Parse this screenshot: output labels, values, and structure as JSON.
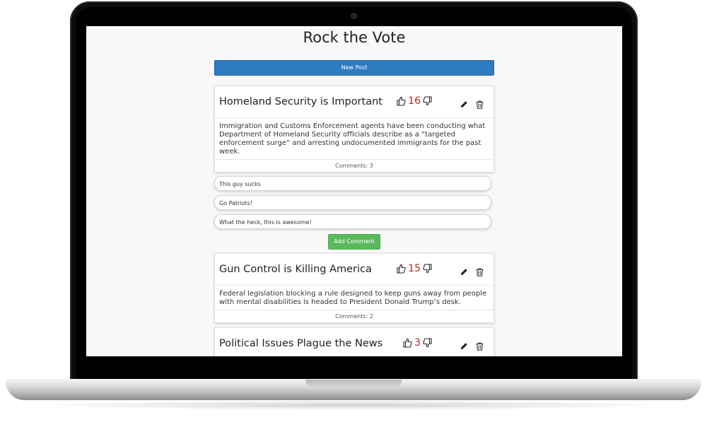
{
  "app": {
    "title": "Rock the Vote",
    "new_post_label": "New Post",
    "add_comment_label": "Add Comment"
  },
  "posts": [
    {
      "title": "Homeland Security is Important",
      "score": "16",
      "body": "Immigration and Customs Enforcement agents have been conducting what Department of Homeland Security officials describe as a “targeted enforcement surge” and arresting undocumented immigrants for the past week.",
      "comments_label": "Comments: 3"
    },
    {
      "title": "Gun Control is Killing America",
      "score": "15",
      "body": "Federal legislation blocking a rule designed to keep guns away from people with mental disabilities is headed to President Donald Trump’s desk.",
      "comments_label": "Comments: 2"
    },
    {
      "title": "Political Issues Plague the News",
      "score": "3"
    }
  ],
  "comments": [
    "This guy sucks",
    "Go Patriots!",
    "What the heck, this is awesome!"
  ],
  "colors": {
    "primary": "#2f7bc1",
    "success": "#5cb85c",
    "score": "#b22a2a"
  },
  "icons": [
    "thumbs-up-icon",
    "thumbs-down-icon",
    "pencil-icon",
    "trash-icon",
    "camera-icon"
  ]
}
